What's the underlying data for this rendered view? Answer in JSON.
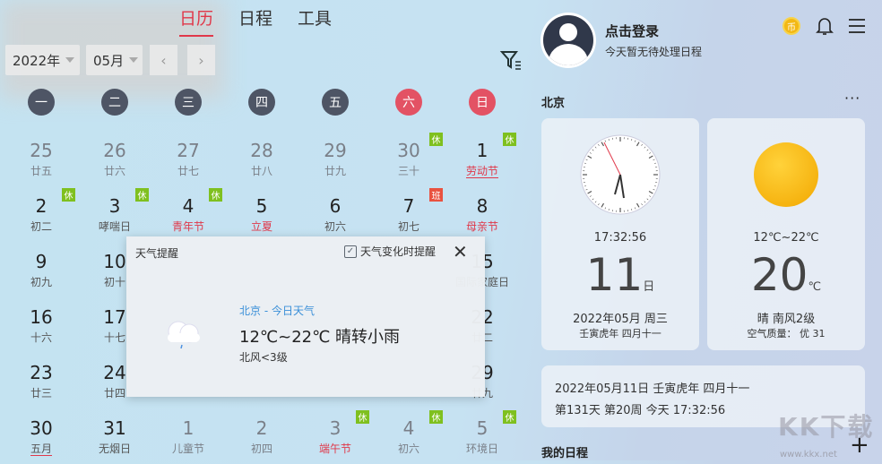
{
  "tabs": [
    {
      "label": "日历",
      "active": true
    },
    {
      "label": "日程",
      "active": false
    },
    {
      "label": "工具",
      "active": false
    }
  ],
  "toolbar": {
    "year": "2022年",
    "month": "05月",
    "prev": "‹",
    "next": "›"
  },
  "weekdays": [
    {
      "label": "一",
      "weekend": false
    },
    {
      "label": "二",
      "weekend": false
    },
    {
      "label": "三",
      "weekend": false
    },
    {
      "label": "四",
      "weekend": false
    },
    {
      "label": "五",
      "weekend": false
    },
    {
      "label": "六",
      "weekend": true
    },
    {
      "label": "日",
      "weekend": true
    }
  ],
  "colors": {
    "accent": "#e0384a",
    "rest": "#7fc01f",
    "work": "#e95240",
    "weekday": "#4e5565"
  },
  "cells": [
    {
      "day": "25",
      "lunar": "廿五",
      "muted": true
    },
    {
      "day": "26",
      "lunar": "廿六",
      "muted": true
    },
    {
      "day": "27",
      "lunar": "廿七",
      "muted": true
    },
    {
      "day": "28",
      "lunar": "廿八",
      "muted": true
    },
    {
      "day": "29",
      "lunar": "廿九",
      "muted": true
    },
    {
      "day": "30",
      "lunar": "三十",
      "muted": true,
      "badge": "休"
    },
    {
      "day": "1",
      "lunar": "劳动节",
      "red": true,
      "underline": true,
      "badge": "休"
    },
    {
      "day": "2",
      "lunar": "初二",
      "badge": "休"
    },
    {
      "day": "3",
      "lunar": "哮喘日",
      "badge": "休"
    },
    {
      "day": "4",
      "lunar": "青年节",
      "red": true,
      "badge": "休"
    },
    {
      "day": "5",
      "lunar": "立夏",
      "red": true
    },
    {
      "day": "6",
      "lunar": "初六"
    },
    {
      "day": "7",
      "lunar": "初七",
      "badge": "班",
      "work": true
    },
    {
      "day": "8",
      "lunar": "母亲节",
      "red": true
    },
    {
      "day": "9",
      "lunar": "初九"
    },
    {
      "day": "10",
      "lunar": "初十"
    },
    {
      "day": "",
      "lunar": ""
    },
    {
      "day": "",
      "lunar": ""
    },
    {
      "day": "",
      "lunar": ""
    },
    {
      "day": "",
      "lunar": ""
    },
    {
      "day": "15",
      "lunar": "国际家庭日"
    },
    {
      "day": "16",
      "lunar": "十六"
    },
    {
      "day": "17",
      "lunar": "十七"
    },
    {
      "day": "",
      "lunar": ""
    },
    {
      "day": "",
      "lunar": ""
    },
    {
      "day": "",
      "lunar": ""
    },
    {
      "day": "",
      "lunar": ""
    },
    {
      "day": "22",
      "lunar": "廿二"
    },
    {
      "day": "23",
      "lunar": "廿三"
    },
    {
      "day": "24",
      "lunar": "廿四"
    },
    {
      "day": "",
      "lunar": ""
    },
    {
      "day": "",
      "lunar": ""
    },
    {
      "day": "",
      "lunar": ""
    },
    {
      "day": "",
      "lunar": ""
    },
    {
      "day": "29",
      "lunar": "廿九"
    },
    {
      "day": "30",
      "lunar": "五月",
      "underline": true
    },
    {
      "day": "31",
      "lunar": "无烟日"
    },
    {
      "day": "1",
      "lunar": "儿童节",
      "muted": true
    },
    {
      "day": "2",
      "lunar": "初四",
      "muted": true
    },
    {
      "day": "3",
      "lunar": "端午节",
      "muted": true,
      "red": true,
      "badge": "休"
    },
    {
      "day": "4",
      "lunar": "初六",
      "muted": true,
      "badge": "休"
    },
    {
      "day": "5",
      "lunar": "环境日",
      "muted": true,
      "badge": "休"
    }
  ],
  "popup": {
    "title": "天气提醒",
    "checkbox_label": "天气变化时提醒",
    "checked": true,
    "close": "✕",
    "city_line": "北京 - 今日天气",
    "temp": "12℃~22℃ 晴转小雨",
    "wind": "北风<3级",
    "icon": "cloud-rain-icon"
  },
  "user": {
    "login": "点击登录",
    "status": "今天暂无待处理日程",
    "coin": "币"
  },
  "city": {
    "name": "北京",
    "more": "···"
  },
  "clock": {
    "time": "17:32:56",
    "day": "11",
    "day_unit": "日",
    "date": "2022年05月 周三",
    "lunar": "壬寅虎年 四月十一"
  },
  "weather": {
    "range": "12℃~22℃",
    "temp": "20",
    "unit": "℃",
    "desc": "晴 南风2级",
    "aqi": "空气质量： 优 31",
    "icon": "sun-icon"
  },
  "info": {
    "line1": "2022年05月11日 壬寅虎年 四月十一",
    "line2": "第131天 第20周 今天 17:32:56"
  },
  "schedule": {
    "title": "我的日程",
    "add": "+"
  },
  "watermark": {
    "text": "KK下载",
    "url": "www.kkx.net"
  }
}
